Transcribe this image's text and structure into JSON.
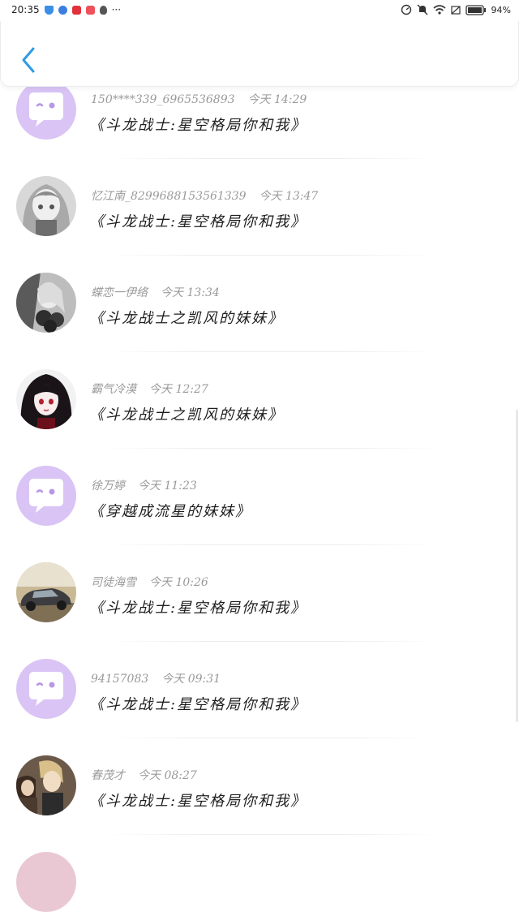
{
  "status_bar": {
    "time": "20:35",
    "more": "···",
    "battery": "94%"
  },
  "header": {
    "back_icon": "chevron-left-icon",
    "accent": "#2f9be6"
  },
  "colors": {
    "default_avatar_bg": "#d9c4f5",
    "default_avatar_bubble": "#ffffff",
    "default_avatar_eyes": "#b797e6"
  },
  "comments": [
    {
      "user": "150****339_6965536893",
      "time": "今天 14:29",
      "book": "《斗龙战士:星空格局你和我》",
      "avatar": "default"
    },
    {
      "user": "忆江南_8299688153561339",
      "time": "今天 13:47",
      "book": "《斗龙战士:星空格局你和我》",
      "avatar": "photo-gray-girl"
    },
    {
      "user": "蝶恋一伊络",
      "time": "今天 13:34",
      "book": "《斗龙战士之凯风的妹妹》",
      "avatar": "photo-flowers-girl"
    },
    {
      "user": "霸气冷漠",
      "time": "今天 12:27",
      "book": "《斗龙战士之凯风的妹妹》",
      "avatar": "photo-dark-hair-girl"
    },
    {
      "user": "徐万婷",
      "time": "今天 11:23",
      "book": "《穿越成流星的妹妹》",
      "avatar": "default"
    },
    {
      "user": "司徒海雪",
      "time": "今天 10:26",
      "book": "《斗龙战士:星空格局你和我》",
      "avatar": "photo-car"
    },
    {
      "user": "94157083",
      "time": "今天 09:31",
      "book": "《斗龙战士:星空格局你和我》",
      "avatar": "default"
    },
    {
      "user": "春茂才",
      "time": "今天 08:27",
      "book": "《斗龙战士:星空格局你和我》",
      "avatar": "photo-anime-boys"
    }
  ]
}
